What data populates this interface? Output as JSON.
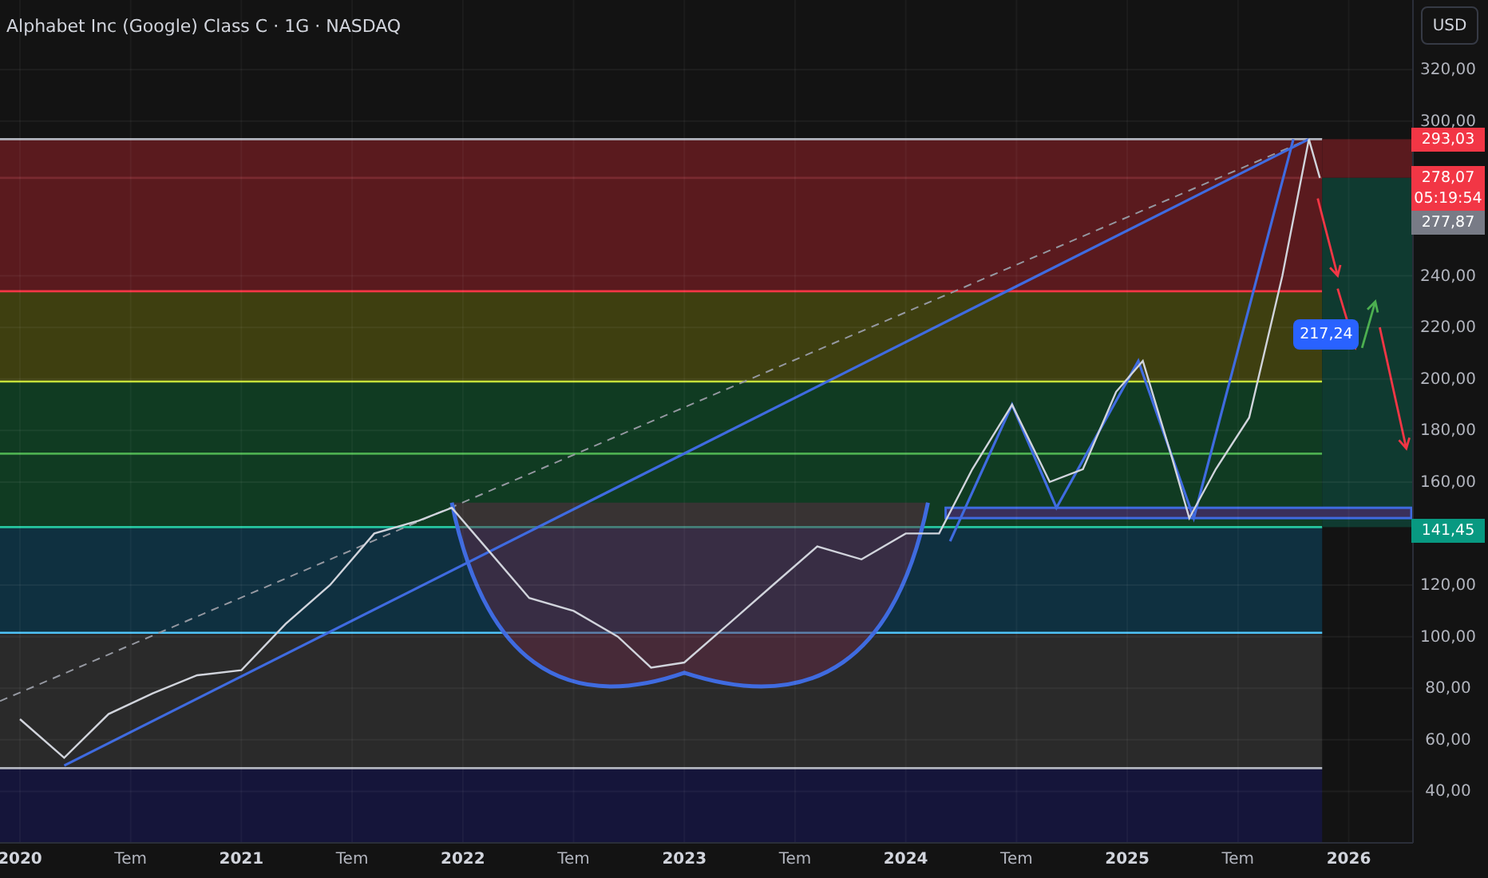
{
  "header": {
    "title": "Alphabet Inc (Google) Class C · 1G · NASDAQ"
  },
  "currency_button": {
    "label": "USD"
  },
  "chart_data": {
    "type": "line",
    "grid": true,
    "xlim": [
      2019.91,
      2026.29
    ],
    "ylim": [
      20,
      347
    ],
    "x": [
      2020.0,
      2020.2,
      2020.4,
      2020.6,
      2020.8,
      2021.0,
      2021.2,
      2021.4,
      2021.6,
      2021.8,
      2021.95,
      2022.1,
      2022.3,
      2022.5,
      2022.7,
      2022.85,
      2023.0,
      2023.2,
      2023.4,
      2023.6,
      2023.8,
      2024.0,
      2024.15,
      2024.3,
      2024.48,
      2024.65,
      2024.8,
      2024.95,
      2025.07,
      2025.2,
      2025.28,
      2025.4,
      2025.55,
      2025.7,
      2025.82,
      2025.87
    ],
    "series": [
      {
        "color": "#d1d4dc",
        "values": [
          68,
          53,
          70,
          78,
          85,
          87,
          105,
          120,
          140,
          145,
          150,
          135,
          115,
          110,
          100,
          88,
          90,
          105,
          120,
          135,
          130,
          140,
          140,
          165,
          190,
          160,
          165,
          195,
          207,
          170,
          146,
          165,
          185,
          240,
          293,
          278
        ]
      }
    ],
    "xticks": [
      {
        "value": 2020,
        "label": "2020"
      },
      {
        "value": 2020.5,
        "label": "Tem"
      },
      {
        "value": 2021,
        "label": "2021"
      },
      {
        "value": 2021.5,
        "label": "Tem"
      },
      {
        "value": 2022,
        "label": "2022"
      },
      {
        "value": 2022.5,
        "label": "Tem"
      },
      {
        "value": 2023,
        "label": "2023"
      },
      {
        "value": 2023.5,
        "label": "Tem"
      },
      {
        "value": 2024,
        "label": "2024"
      },
      {
        "value": 2024.5,
        "label": "Tem"
      },
      {
        "value": 2025,
        "label": "2025"
      },
      {
        "value": 2025.5,
        "label": "Tem"
      },
      {
        "value": 2026,
        "label": "2026"
      }
    ],
    "yticks": [
      {
        "value": 320,
        "label": "320,00"
      },
      {
        "value": 300,
        "label": "300,00"
      },
      {
        "value": 240,
        "label": "240,00"
      },
      {
        "value": 220,
        "label": "220,00"
      },
      {
        "value": 200,
        "label": "200,00"
      },
      {
        "value": 180,
        "label": "180,00"
      },
      {
        "value": 160,
        "label": "160,00"
      },
      {
        "value": 120,
        "label": "120,00"
      },
      {
        "value": 100,
        "label": "100,00"
      },
      {
        "value": 80,
        "label": "80,00"
      },
      {
        "value": 60,
        "label": "60,00"
      },
      {
        "value": 40,
        "label": "40,00"
      }
    ],
    "annotations": [
      "293,03",
      "278,07",
      "277,87",
      "141,45",
      "217,24"
    ]
  },
  "price_tags": [
    {
      "kind": "axis",
      "color": "#f23645"
    },
    {
      "kind": "axis",
      "subtext": "05:19:54",
      "color": "#f23645"
    },
    {
      "kind": "axis",
      "color": "#787b86"
    },
    {
      "kind": "axis",
      "color": "#089981"
    },
    {
      "kind": "marker",
      "color": "#2962ff"
    }
  ]
}
